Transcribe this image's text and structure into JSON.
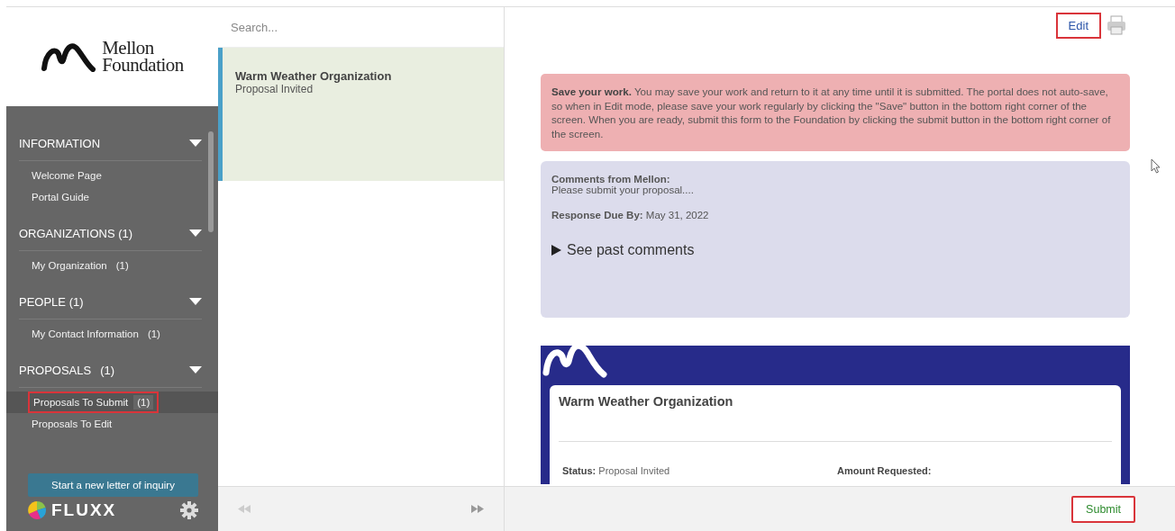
{
  "sidebar": {
    "logo": {
      "line_1": "Mellon",
      "line_2": "Foundation"
    },
    "sections": [
      {
        "title": "INFORMATION",
        "expanded": true,
        "items": [
          {
            "label": "Welcome Page",
            "selected": false,
            "highlighted": false
          },
          {
            "label": "Portal Guide",
            "selected": false,
            "highlighted": false
          }
        ]
      },
      {
        "title": "ORGANIZATIONS (1)",
        "expanded": true,
        "items": [
          {
            "label": "My Organization",
            "count": "(1)",
            "selected": false,
            "highlighted": false
          }
        ]
      },
      {
        "title": "PEOPLE (1)",
        "expanded": true,
        "items": [
          {
            "label": "My Contact Information",
            "count": "(1)",
            "selected": false,
            "highlighted": false
          }
        ]
      },
      {
        "title": "PROPOSALS",
        "count": "(1)",
        "expanded": true,
        "items": [
          {
            "label": "Proposals To Submit",
            "count": "(1)",
            "selected": true,
            "highlighted": true
          },
          {
            "label": "Proposals To Edit",
            "selected": false,
            "highlighted": false
          }
        ]
      }
    ],
    "new_loi_button": "Start a new letter of inquiry",
    "brand": "FLUXX"
  },
  "list": {
    "search": {
      "placeholder": "Search..."
    },
    "cards": [
      {
        "title": "Warm Weather Organization",
        "status": "Proposal Invited",
        "selected": true
      }
    ]
  },
  "detail": {
    "edit_button": {
      "label": "Edit",
      "highlighted": true
    },
    "alert": "**Save your work.** You may save your work and return to it at any time until it is submitted. The portal does not auto-save, so when in Edit mode, please save your work regularly by clicking the \"Save\" button in the bottom right corner of the screen.  When you are ready, submit this form to the Foundation by clicking the submit button in the bottom right corner of the screen.",
    "comments": {
      "heading": "Comments from Mellon:",
      "text": "Please submit your proposal....",
      "due_label": "Response Due By:",
      "due_value": "May 31, 2022",
      "toggle": "See past comments",
      "expanded": false
    },
    "form": {
      "title": "Warm Weather Organization",
      "fields": [
        {
          "label": "Status:",
          "value": "Proposal Invited"
        },
        {
          "label": "Amount Requested:"
        }
      ]
    },
    "submit_button": {
      "label": "Submit",
      "highlighted": true
    }
  }
}
